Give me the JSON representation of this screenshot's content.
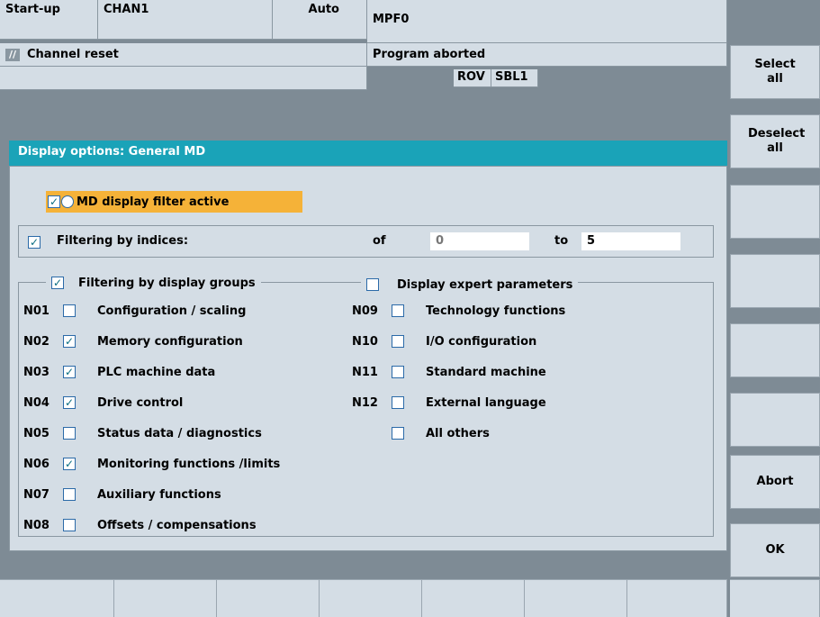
{
  "header": {
    "area": "Start-up",
    "channel": "CHAN1",
    "mode": "Auto",
    "program": "MPF0",
    "channel_status": "Channel reset",
    "program_status": "Program aborted",
    "rov": "ROV",
    "sbl": "SBL1"
  },
  "dialog": {
    "title": "Display options: General MD",
    "filter_active_label": "MD display filter active",
    "filter_indices_label": "Filtering by indices:",
    "of_label": "of",
    "of_value": "0",
    "to_label": "to",
    "to_value": "5",
    "groups_label": "Filtering by display groups",
    "expert_label": "Display expert parameters",
    "groups_left": [
      {
        "code": "N01",
        "label": "Configuration / scaling",
        "checked": false
      },
      {
        "code": "N02",
        "label": "Memory configuration",
        "checked": true
      },
      {
        "code": "N03",
        "label": "PLC machine data",
        "checked": true
      },
      {
        "code": "N04",
        "label": "Drive control",
        "checked": true
      },
      {
        "code": "N05",
        "label": "Status data / diagnostics",
        "checked": false
      },
      {
        "code": "N06",
        "label": "Monitoring functions /limits",
        "checked": true
      },
      {
        "code": "N07",
        "label": "Auxiliary functions",
        "checked": false
      },
      {
        "code": "N08",
        "label": "Offsets / compensations",
        "checked": false
      }
    ],
    "groups_right": [
      {
        "code": "N09",
        "label": "Technology functions",
        "checked": false
      },
      {
        "code": "N10",
        "label": "I/O configuration",
        "checked": false
      },
      {
        "code": "N11",
        "label": "Standard machine",
        "checked": false
      },
      {
        "code": "N12",
        "label": "External language",
        "checked": false
      },
      {
        "code": "",
        "label": "All others",
        "checked": false
      }
    ]
  },
  "softkeys": {
    "select_all": "Select all",
    "deselect_all": "Deselect all",
    "abort": "Abort",
    "ok": "OK"
  },
  "colors": {
    "title_bar": "#1aa3b8",
    "highlight": "#f5b238",
    "check": "#0b6e82"
  }
}
